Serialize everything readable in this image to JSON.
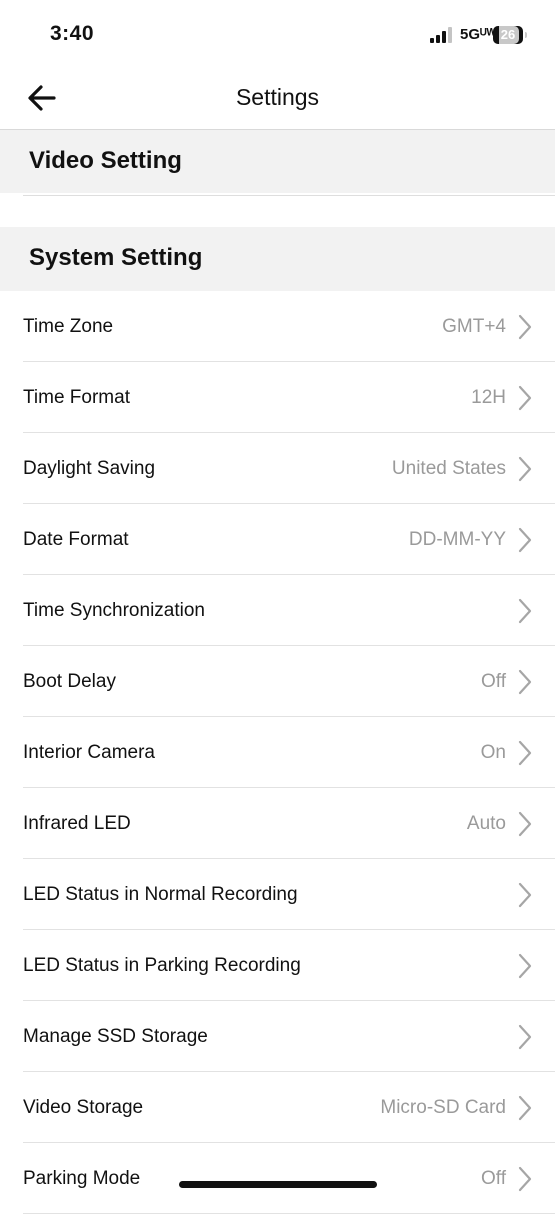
{
  "status_bar": {
    "time": "3:40",
    "network": "5Gᵁᵂ",
    "battery": "26"
  },
  "header": {
    "title": "Settings"
  },
  "sections": {
    "video": "Video Setting",
    "system": "System Setting"
  },
  "settings": [
    {
      "label": "Time Zone",
      "value": "GMT+4"
    },
    {
      "label": "Time Format",
      "value": "12H"
    },
    {
      "label": "Daylight Saving",
      "value": "United States"
    },
    {
      "label": "Date Format",
      "value": "DD-MM-YY"
    },
    {
      "label": "Time Synchronization",
      "value": ""
    },
    {
      "label": "Boot Delay",
      "value": "Off"
    },
    {
      "label": "Interior Camera",
      "value": "On"
    },
    {
      "label": "Infrared LED",
      "value": "Auto"
    },
    {
      "label": "LED Status in Normal Recording",
      "value": ""
    },
    {
      "label": "LED Status in Parking Recording",
      "value": ""
    },
    {
      "label": "Manage SSD Storage",
      "value": ""
    },
    {
      "label": "Video Storage",
      "value": "Micro-SD Card"
    },
    {
      "label": "Parking Mode",
      "value": "Off"
    }
  ],
  "icons": {
    "back": "arrow-left-icon",
    "chevron": "chevron-right-icon",
    "signal": "cellular-signal-icon",
    "battery": "battery-icon"
  },
  "colors": {
    "section_background": "#f2f2f2",
    "value_text": "#9a9a9a",
    "chevron": "#a6a6a6"
  }
}
